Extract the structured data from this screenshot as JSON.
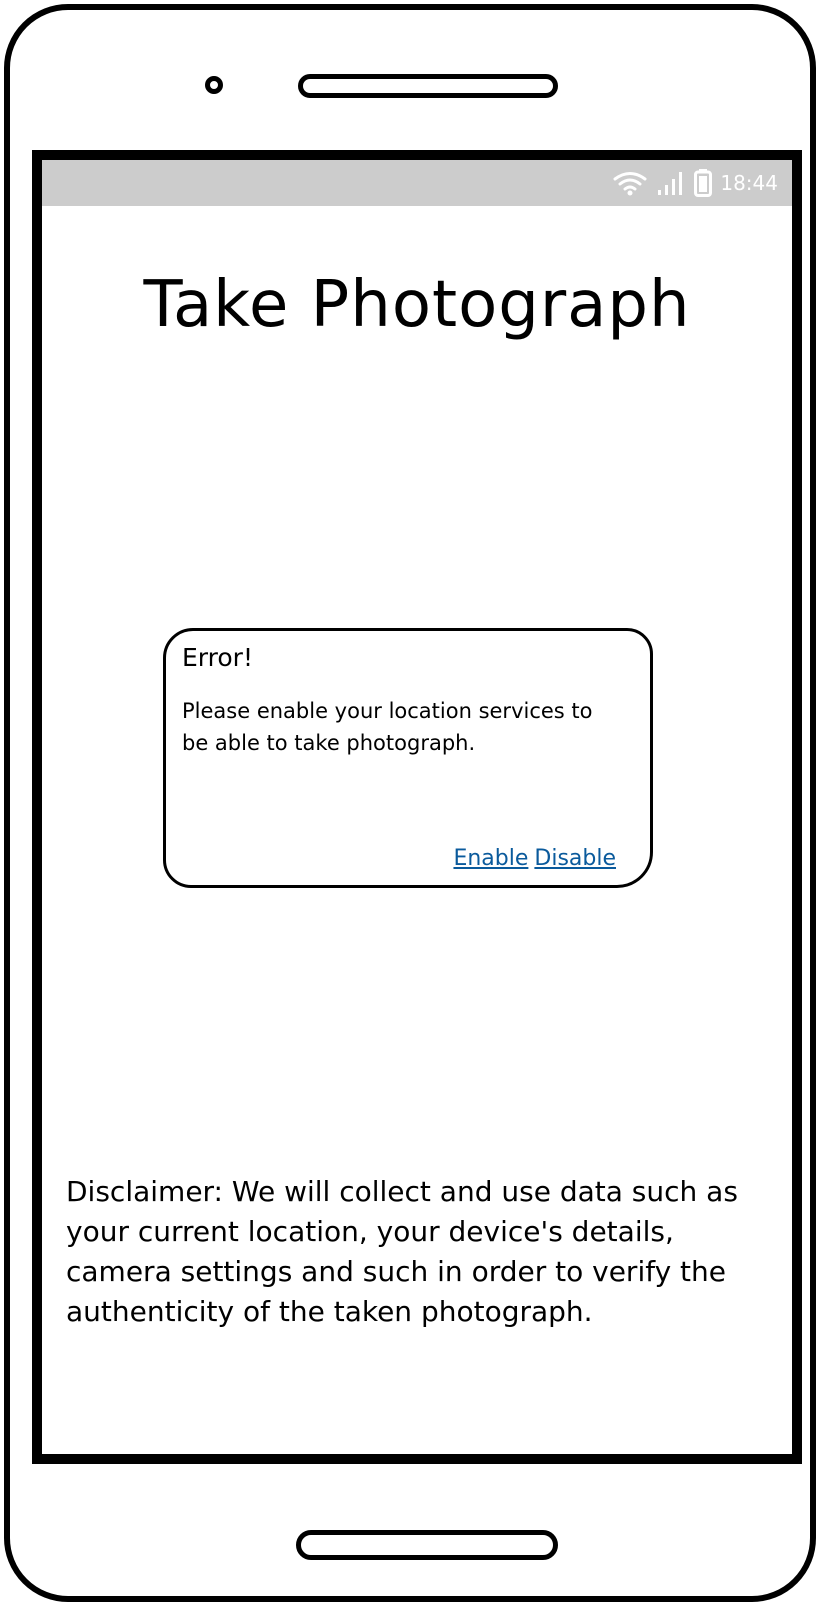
{
  "status_bar": {
    "time": "18:44",
    "icons": [
      "wifi-icon",
      "signal-icon",
      "battery-icon"
    ],
    "background": "#cccccc"
  },
  "page": {
    "title": "Take Photograph"
  },
  "dialog": {
    "title": "Error!",
    "message": "Please enable your location services to be able to take photograph.",
    "enable_label": "Enable",
    "disable_label": "Disable",
    "link_color": "#0a5a9c"
  },
  "disclaimer": {
    "text": "Disclaimer: We will collect and use data such as your current location, your device's details, camera settings and such in order to verify the authenticity of the taken photograph."
  }
}
